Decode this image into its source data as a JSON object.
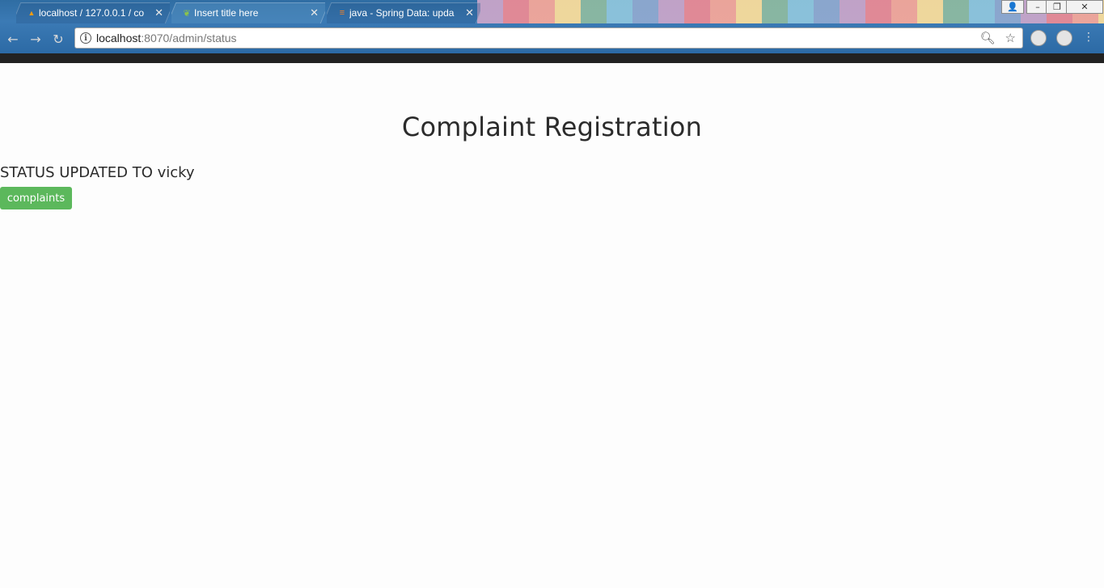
{
  "browser": {
    "tabs": [
      {
        "title": "localhost / 127.0.0.1 / co",
        "favicon": "phpmyadmin-icon",
        "active": false
      },
      {
        "title": "Insert title here",
        "favicon": "spring-leaf-icon",
        "active": true
      },
      {
        "title": "java - Spring Data: upda",
        "favicon": "stackoverflow-icon",
        "active": false
      }
    ],
    "url": {
      "host": "localhost",
      "path": ":8070/admin/status"
    },
    "colors": {
      "chrome": "#2f6da3",
      "toolbar_strip": "#222222"
    }
  },
  "page": {
    "title": "Complaint Registration",
    "status_message": "STATUS UPDATED TO vicky",
    "complaints_button": "complaints",
    "colors": {
      "button": "#5cb85c",
      "text": "#2b2b2b",
      "background": "#fdfdfd"
    }
  }
}
